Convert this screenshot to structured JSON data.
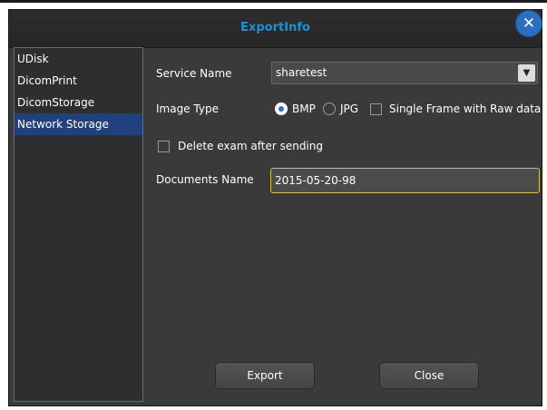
{
  "dialog": {
    "title": "ExportInfo",
    "close_icon": "close-icon"
  },
  "sidebar": {
    "items": [
      {
        "label": "UDisk"
      },
      {
        "label": "DicomPrint"
      },
      {
        "label": "DicomStorage"
      },
      {
        "label": "Network Storage",
        "selected": true
      }
    ]
  },
  "form": {
    "service_name_label": "Service Name",
    "service_name_value": "sharetest",
    "image_type_label": "Image Type",
    "image_type_options": [
      {
        "label": "BMP",
        "selected": true
      },
      {
        "label": "JPG",
        "selected": false
      }
    ],
    "single_frame_label": "Single Frame with Raw data",
    "single_frame_checked": false,
    "delete_exam_label": "Delete exam after sending",
    "delete_exam_checked": false,
    "documents_name_label": "Documents Name",
    "documents_name_value": "2015-05-20-98"
  },
  "buttons": {
    "export_label": "Export",
    "close_label": "Close"
  },
  "colors": {
    "title": "#1e8fd8",
    "selected_item": "#21407e",
    "focus_border": "#d8c23a"
  }
}
